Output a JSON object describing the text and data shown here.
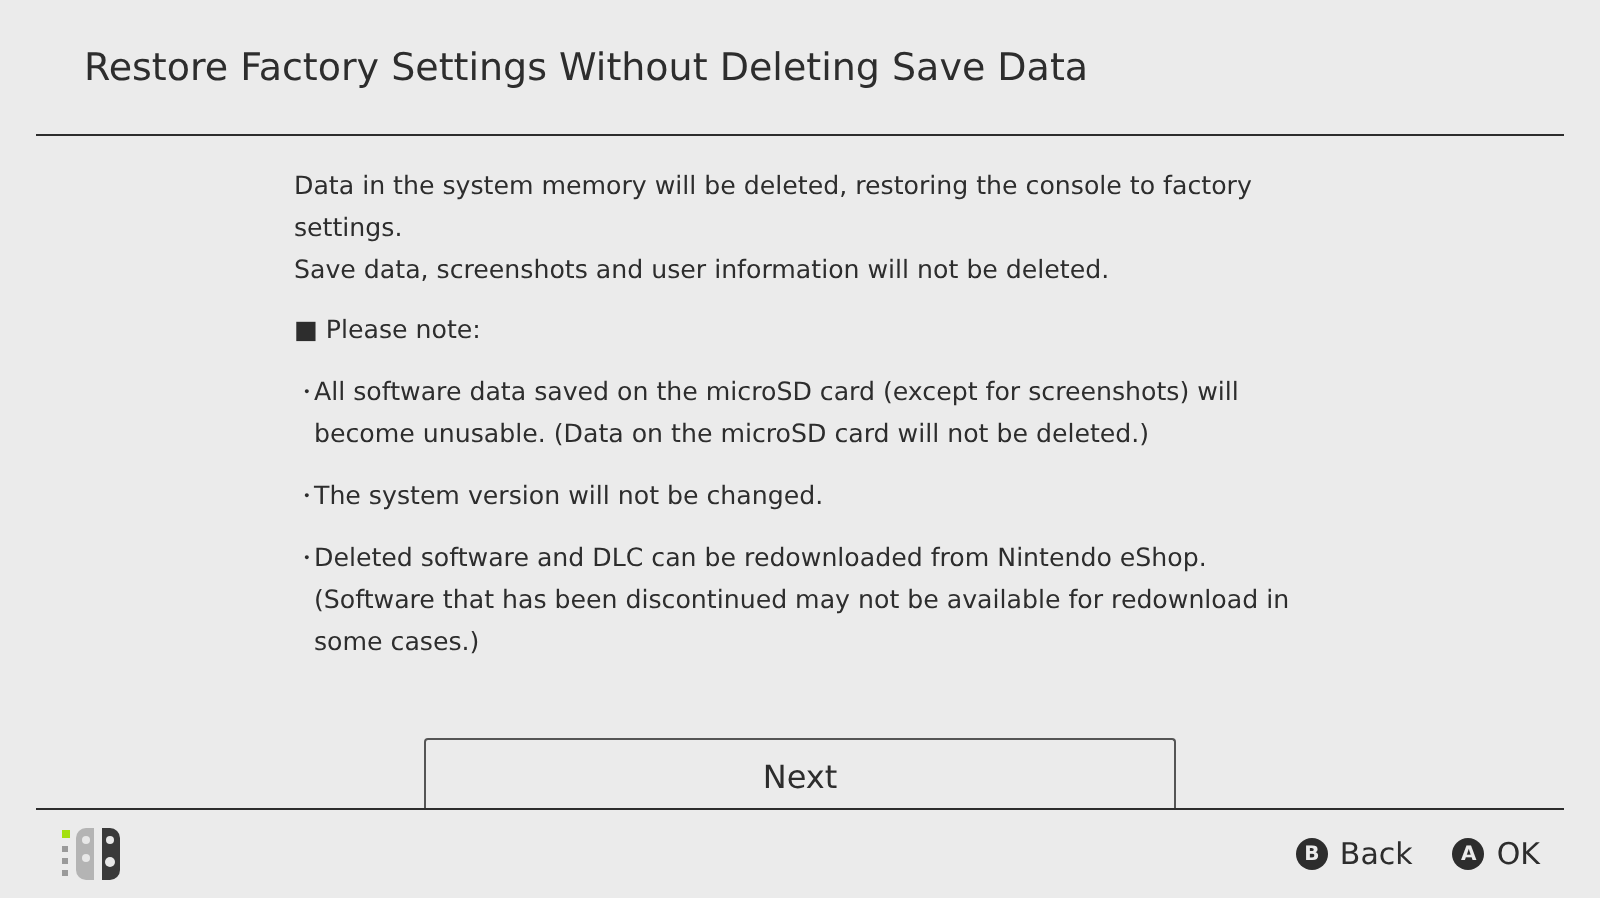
{
  "window": {
    "title": "Restore Factory Settings Without Deleting Save Data"
  },
  "body": {
    "paragraphs": [
      "Data in the system memory will be deleted, restoring the console to factory settings.",
      "Save data, screenshots and user information will not be deleted."
    ],
    "note": {
      "marker": "■",
      "text": "Please note:"
    },
    "bullets": [
      {
        "marker": "・",
        "text": "All software data saved on the microSD card (except for screenshots) will become unusable. (Data on the microSD card will not be deleted.)"
      },
      {
        "marker": "・",
        "text": "The system version will not be changed."
      },
      {
        "marker": "・",
        "text": "Deleted software and DLC can be redownloaded from Nintendo eShop. (Software that has been discontinued may not be available for redownload in some cases.)"
      }
    ]
  },
  "primary_button": "Next",
  "footer": {
    "actions": [
      {
        "key": "B",
        "label": "Back"
      },
      {
        "key": "A",
        "label": "OK"
      }
    ]
  }
}
